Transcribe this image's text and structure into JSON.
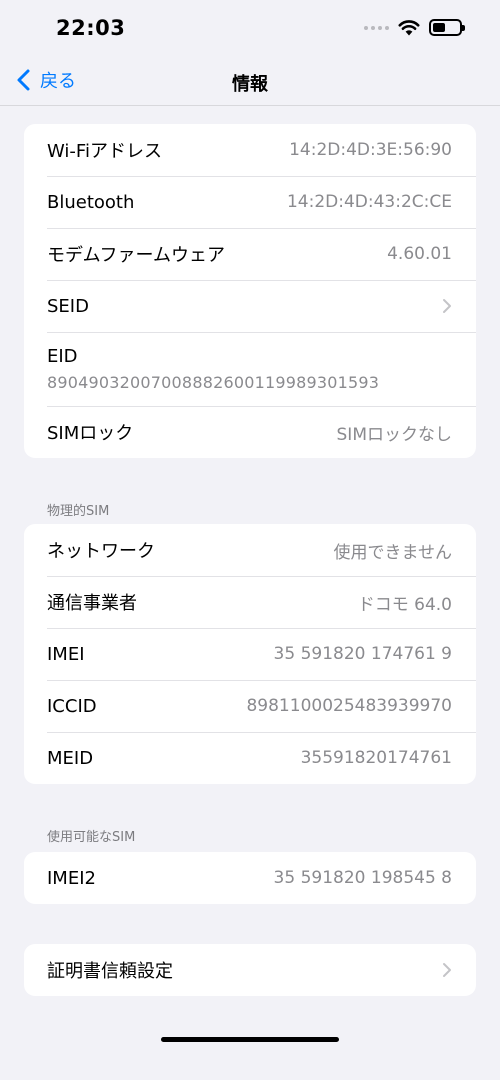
{
  "status_bar": {
    "time": "22:03",
    "icons": [
      "cellular-dots-icon",
      "wifi-icon",
      "battery-icon"
    ],
    "battery_level": 0.42
  },
  "nav": {
    "back_label": "戻る",
    "title": "情報"
  },
  "group1": {
    "rows": [
      {
        "label": "Wi-Fiアドレス",
        "value": "14:2D:4D:3E:56:90"
      },
      {
        "label": "Bluetooth",
        "value": "14:2D:4D:43:2C:CE"
      },
      {
        "label": "モデムファームウェア",
        "value": "4.60.01"
      },
      {
        "label": "SEID",
        "value": ""
      },
      {
        "label": "EID",
        "value": "89049032007008882600119989301593"
      },
      {
        "label": "SIMロック",
        "value": "SIMロックなし"
      }
    ]
  },
  "physical_sim": {
    "header": "物理的SIM",
    "rows": [
      {
        "label": "ネットワーク",
        "value": "使用できません"
      },
      {
        "label": "通信事業者",
        "value": "ドコモ 64.0"
      },
      {
        "label": "IMEI",
        "value": "35 591820 174761 9"
      },
      {
        "label": "ICCID",
        "value": "8981100025483939970"
      },
      {
        "label": "MEID",
        "value": "35591820174761"
      }
    ]
  },
  "available_sim": {
    "header": "使用可能なSIM",
    "rows": [
      {
        "label": "IMEI2",
        "value": "35 591820 198545 8"
      }
    ]
  },
  "certificate": {
    "label": "証明書信頼設定"
  },
  "colors": {
    "accent": "#007aff",
    "background": "#f2f2f7",
    "secondary_text": "#8a8a8e"
  }
}
